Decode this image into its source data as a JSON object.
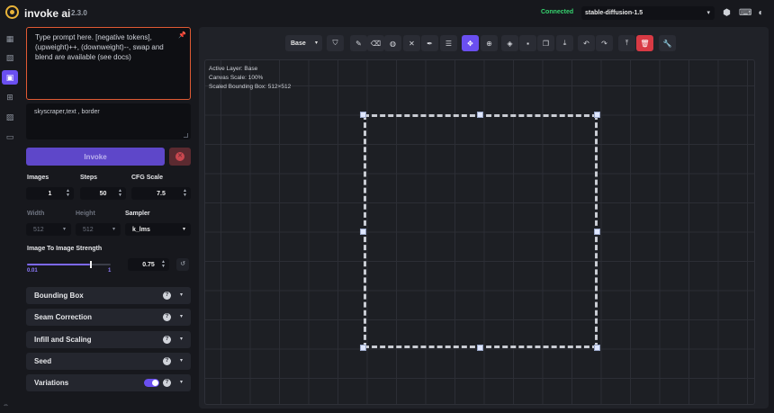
{
  "header": {
    "app_name": "invoke ai",
    "version": "2.3.0",
    "status": "Connected",
    "model": "stable-diffusion-1.5",
    "icons": [
      "cube-icon",
      "keyboard-icon",
      "palette-icon"
    ]
  },
  "nav": {
    "items": [
      "text-to-image-icon",
      "image-to-image-icon",
      "unified-canvas-icon",
      "nodes-icon",
      "postprocessing-icon",
      "training-icon"
    ],
    "active_index": 2
  },
  "prompt": {
    "placeholder": "Type prompt here. [negative tokens], (upweight)++, (downweight)--, swap and blend are available (see docs)",
    "negative_value": "skyscraper,text , border"
  },
  "actions": {
    "invoke_label": "Invoke"
  },
  "params": {
    "images_label": "Images",
    "images_value": "1",
    "steps_label": "Steps",
    "steps_value": "50",
    "cfg_label": "CFG Scale",
    "cfg_value": "7.5",
    "width_label": "Width",
    "width_value": "512",
    "height_label": "Height",
    "height_value": "512",
    "sampler_label": "Sampler",
    "sampler_value": "k_lms",
    "strength_label": "Image To Image Strength",
    "strength_min": "0.01",
    "strength_max": "1",
    "strength_value": "0.75",
    "strength_fraction": 0.75
  },
  "accordions": [
    {
      "label": "Bounding Box"
    },
    {
      "label": "Seam Correction"
    },
    {
      "label": "Infill and Scaling"
    },
    {
      "label": "Seed"
    },
    {
      "label": "Variations",
      "toggle_on": true
    }
  ],
  "canvas": {
    "layer": "Base",
    "info_layer": "Active Layer: Base",
    "info_scale": "Canvas Scale: 100%",
    "info_bbox": "Scaled Bounding Box: 512×512",
    "accent_color": "#6a4ff0",
    "danger_color": "#d83a44"
  }
}
